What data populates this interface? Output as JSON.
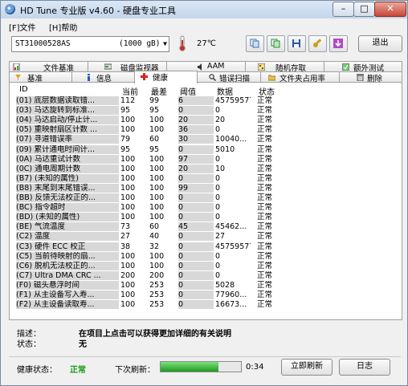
{
  "window": {
    "title": "HD Tune 专业版 v4.60 - 硬盘专业工具"
  },
  "menu": {
    "file": "[F]文件",
    "help": "[H]帮助"
  },
  "toolbar": {
    "drive_name": "ST31000528AS",
    "drive_size": "(1000 gB)",
    "temperature": "27℃",
    "exit": "退出"
  },
  "tabs_top": [
    "文件基准",
    "磁盘监视器",
    "AAM",
    "随机存取",
    "额外测试"
  ],
  "tabs_bottom": [
    "基准",
    "信息",
    "健康",
    "错误扫描",
    "文件夹占用率",
    "删除"
  ],
  "table": {
    "headers": [
      "ID",
      "当前",
      "最差",
      "阈值",
      "数据",
      "状态"
    ],
    "rows": [
      [
        "(01) 底层数据读取错...",
        "112",
        "99",
        "6",
        "45759577",
        "正常"
      ],
      [
        "(03) 马达旋转到标准...",
        "95",
        "95",
        "0",
        "0",
        "正常"
      ],
      [
        "(04) 马达启动/停止计...",
        "100",
        "100",
        "20",
        "20",
        "正常"
      ],
      [
        "(05) 重映射扇区计数 ...",
        "100",
        "100",
        "36",
        "0",
        "正常"
      ],
      [
        "(07) 寻道错误率",
        "79",
        "60",
        "30",
        "10040...",
        "正常"
      ],
      [
        "(09) 累计通电时间计...",
        "95",
        "95",
        "0",
        "5010",
        "正常"
      ],
      [
        "(0A) 马达重试计数",
        "100",
        "100",
        "97",
        "0",
        "正常"
      ],
      [
        "(0C) 通电周期计数",
        "100",
        "100",
        "20",
        "10",
        "正常"
      ],
      [
        "(B7) (未知的属性)",
        "100",
        "100",
        "0",
        "0",
        "正常"
      ],
      [
        "(B8) 末尾到末尾错误...",
        "100",
        "100",
        "99",
        "0",
        "正常"
      ],
      [
        "(BB) 反馈无法校正的...",
        "100",
        "100",
        "0",
        "0",
        "正常"
      ],
      [
        "(BC) 指令超时",
        "100",
        "100",
        "0",
        "0",
        "正常"
      ],
      [
        "(BD) (未知的属性)",
        "100",
        "100",
        "0",
        "0",
        "正常"
      ],
      [
        "(BE) 气流温度",
        "73",
        "60",
        "45",
        "45462...",
        "正常"
      ],
      [
        "(C2) 温度",
        "27",
        "40",
        "0",
        "27",
        "正常"
      ],
      [
        "(C3) 硬件 ECC 校正",
        "38",
        "32",
        "0",
        "45759577",
        "正常"
      ],
      [
        "(C5) 当前待映射的扇...",
        "100",
        "100",
        "0",
        "0",
        "正常"
      ],
      [
        "(C6) 脱机无法校正的...",
        "100",
        "100",
        "0",
        "0",
        "正常"
      ],
      [
        "(C7) Ultra DMA CRC ...",
        "200",
        "200",
        "0",
        "0",
        "正常"
      ],
      [
        "(F0) 磁头悬浮时间",
        "100",
        "253",
        "0",
        "5028",
        "正常"
      ],
      [
        "(F1) 从主设备写入寿...",
        "100",
        "253",
        "0",
        "77960...",
        "正常"
      ],
      [
        "(F2) 从主设备读取寿...",
        "100",
        "253",
        "0",
        "16673...",
        "正常"
      ]
    ]
  },
  "info": {
    "desc_label": "描述：",
    "desc_value": "在项目上点击可以获得更加详细的有关说明",
    "state_label": "状态：",
    "state_value": "无"
  },
  "status_bar": {
    "health_label": "健康状态：",
    "health_value": "正常",
    "next_refresh_label": "下次刷新：",
    "refresh_progress": 0.72,
    "timer": "0:34",
    "refresh_button": "立即刷新",
    "log_button": "日志"
  },
  "colors": {
    "health_ok": "#1a9a1a",
    "progress": "#1f9a1f"
  }
}
